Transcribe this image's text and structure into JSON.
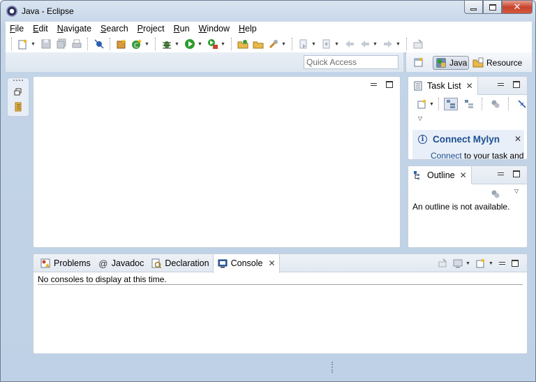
{
  "window": {
    "title": "Java - Eclipse",
    "controls": {
      "minimize": "▁",
      "maximize": "□",
      "close": "✕"
    }
  },
  "menu": {
    "items": [
      {
        "hotkey": "F",
        "rest": "ile"
      },
      {
        "hotkey": "E",
        "rest": "dit"
      },
      {
        "hotkey": "N",
        "rest": "avigate"
      },
      {
        "hotkey": "S",
        "rest": "earch"
      },
      {
        "hotkey": "P",
        "rest": "roject"
      },
      {
        "hotkey": "R",
        "rest": "un"
      },
      {
        "hotkey": "W",
        "rest": "indow"
      },
      {
        "hotkey": "H",
        "rest": "elp"
      }
    ]
  },
  "quick_access": {
    "placeholder": "Quick Access"
  },
  "perspectives": {
    "java": "Java",
    "resource": "Resource"
  },
  "task_list": {
    "tab_label": "Task List",
    "mylyn_title": "Connect Mylyn",
    "mylyn_link": "Connect",
    "mylyn_text": " to your task and"
  },
  "outline": {
    "tab_label": "Outline",
    "message": "An outline is not available."
  },
  "bottom_panel": {
    "tabs": [
      {
        "label": "Problems",
        "icon": "problems-icon"
      },
      {
        "label": "Javadoc",
        "icon": "javadoc-icon"
      },
      {
        "label": "Declaration",
        "icon": "declaration-icon"
      },
      {
        "label": "Console",
        "icon": "console-icon",
        "active": true
      }
    ],
    "console_message": "No consoles to display at this time."
  },
  "colors": {
    "frame": "#c3d4e7",
    "mylyn_blue": "#1d4f91",
    "run_green": "#2a9d2a",
    "close_red": "#c7452e"
  }
}
